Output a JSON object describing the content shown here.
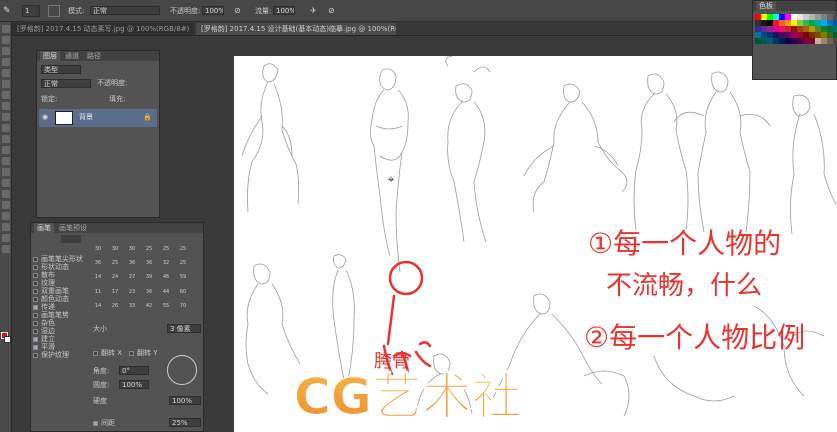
{
  "options_bar": {
    "mode_label": "模式:",
    "mode_value": "正常",
    "opacity_label": "不透明度:",
    "opacity_value": "100%",
    "flow_label": "流量:",
    "flow_value": "100%",
    "brush_size": "1"
  },
  "document_tabs": [
    {
      "label": "[罗格韵] 2017.4.15 动态素写.jpg @ 100%(RGB/8#)",
      "active": false
    },
    {
      "label": "[罗格韵] 2017.4.15 设计基础(基本动态)临摹.jpg @ 100%(RGB/8#)",
      "active": true
    }
  ],
  "layers_panel": {
    "tabs": [
      "图层",
      "通道",
      "路径"
    ],
    "kind_label": "类型",
    "blend_value": "正常",
    "opacity_label": "不透明度:",
    "lock_label": "锁定:",
    "fill_label": "填充:",
    "layer_name": "背景"
  },
  "swatches_panel": {
    "title": "色板",
    "colors": [
      "#ff0000",
      "#ffff00",
      "#00ff00",
      "#00ffff",
      "#0000ff",
      "#ff00ff",
      "#ffffff",
      "#e6e6e6",
      "#cccccc",
      "#b3b3b3",
      "#999999",
      "#808080",
      "#666666",
      "#4d4d4d",
      "#333333",
      "#1a1a1a",
      "#000000",
      "#ed1c24",
      "#f26522",
      "#f7941d",
      "#fff200",
      "#8dc63f",
      "#39b54a",
      "#00a651",
      "#00a99d",
      "#00aeef",
      "#0072bc",
      "#0054a6",
      "#2e3192",
      "#662d91",
      "#92278f",
      "#ec008c",
      "#ed145b",
      "#c1272d",
      "#9e0b0f",
      "#a0410d",
      "#a3620a",
      "#aba000",
      "#598527",
      "#197b30",
      "#007236",
      "#00746b",
      "#0076a3",
      "#004a80",
      "#003471",
      "#1b1464",
      "#440e62",
      "#630460",
      "#9e005d",
      "#9e0039",
      "#790000",
      "#7b2e00",
      "#7d4900",
      "#827b00",
      "#406618",
      "#005e20",
      "#005826",
      "#005952",
      "#005b7f",
      "#003663",
      "#002157",
      "#0d004c",
      "#32004b",
      "#4b0049",
      "#7b0046",
      "#7a0026",
      "#c7b299",
      "#998675",
      "#736357",
      "#534741"
    ]
  },
  "brush_panel": {
    "tabs": [
      "画笔",
      "画笔预设"
    ],
    "items": [
      {
        "label": "画笔笔尖形状",
        "checked": false
      },
      {
        "label": "形状动态",
        "checked": false
      },
      {
        "label": "散布",
        "checked": false
      },
      {
        "label": "纹理",
        "checked": false
      },
      {
        "label": "双重画笔",
        "checked": false
      },
      {
        "label": "颜色动态",
        "checked": false
      },
      {
        "label": "传递",
        "checked": true
      },
      {
        "label": "画笔笔势",
        "checked": false
      },
      {
        "label": "杂色",
        "checked": false
      },
      {
        "label": "湿边",
        "checked": false
      },
      {
        "label": "建立",
        "checked": true
      },
      {
        "label": "平滑",
        "checked": true
      },
      {
        "label": "保护纹理",
        "checked": false
      }
    ],
    "tip_sizes": [
      "30",
      "30",
      "30",
      "25",
      "25",
      "25",
      "36",
      "25",
      "36",
      "36",
      "32",
      "25",
      "14",
      "24",
      "27",
      "39",
      "46",
      "59",
      "11",
      "17",
      "23",
      "36",
      "44",
      "60",
      "14",
      "26",
      "33",
      "42",
      "55",
      "70"
    ],
    "size_label": "大小",
    "size_value": "3 像素",
    "flip_x": "翻转 X",
    "flip_y": "翻转 Y",
    "angle_label": "角度:",
    "angle_value": "0°",
    "roundness_label": "圆度:",
    "roundness_value": "100%",
    "hardness_label": "硬度",
    "hardness_value": "100%",
    "spacing_label": "间距",
    "spacing_value": "25%"
  },
  "canvas_annotations": {
    "note1": "①每一个人物的",
    "note1b": "不流畅，什么",
    "note2": "②每一个人物比例",
    "pelvis": "胯骨"
  },
  "watermark": {
    "text": "CG艺术社"
  }
}
